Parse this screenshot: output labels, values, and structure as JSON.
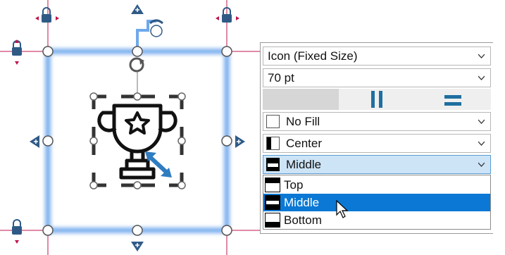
{
  "canvas": {
    "icon": "trophy-icon",
    "handle_icons": [
      "lock-icon",
      "plus-arrow-icon",
      "rotate-icon",
      "resize-arrow-icon"
    ]
  },
  "format_panel": {
    "size_mode": "Icon (Fixed Size)",
    "font_size": "70 pt",
    "orientation_toggles": [
      "blank",
      "vertical-bars-icon",
      "horizontal-bars-icon"
    ],
    "fill": "No Fill",
    "horizontal_align": "Center",
    "vertical_align": "Middle",
    "vertical_align_options": [
      "Top",
      "Middle",
      "Bottom"
    ],
    "highlighted_option": "Middle"
  },
  "colors": {
    "selection_blue": "#6fa8ec",
    "guide_red": "#c0144c",
    "handle_blue": "#2f5a86",
    "highlight": "#0a78d4",
    "accent_teal": "#1f6fa0"
  }
}
